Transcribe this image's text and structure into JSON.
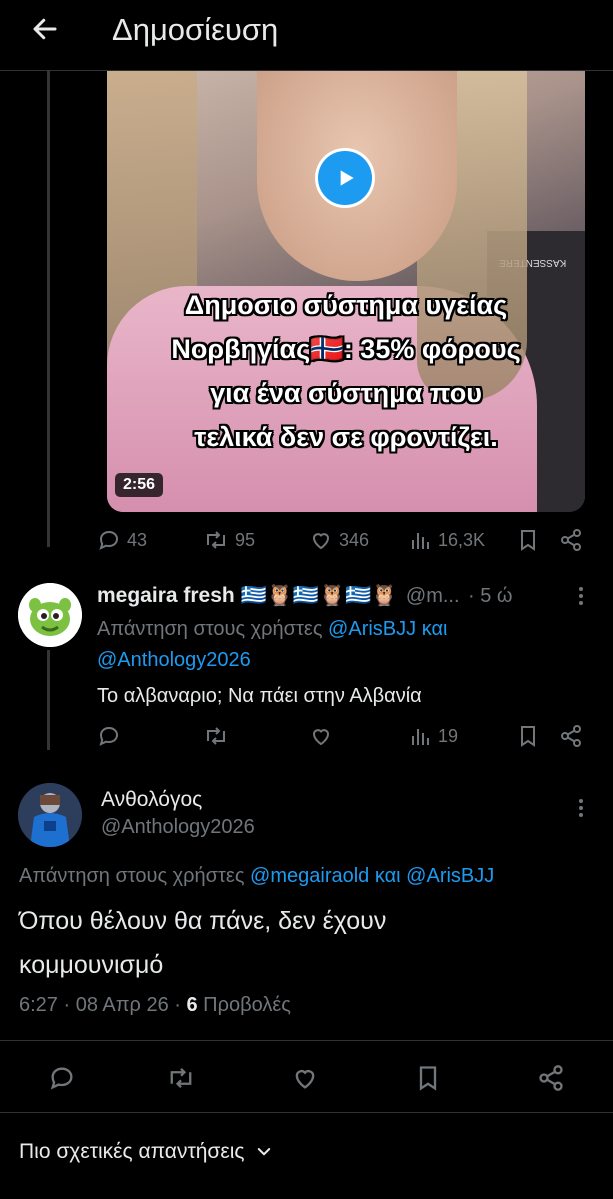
{
  "header": {
    "title": "Δημοσίευση"
  },
  "video": {
    "caption_lines": [
      "Δημοσιο σύστημα υγείας",
      "Νορβηγίας🇳🇴: 35% φόρους",
      "για ένα σύστημα που",
      "τελικά δεν σε φροντίζει."
    ],
    "duration": "2:56",
    "overlay_text": "KASSENTERE"
  },
  "post_stats": {
    "replies": "43",
    "reposts": "95",
    "likes": "346",
    "views": "16,3K"
  },
  "reply1": {
    "name": "megaira fresh 🇬🇷🦉🇬🇷🦉🇬🇷🦉",
    "handle": "@m...",
    "time": "· 5 ώ",
    "reply_prefix": "Απάντηση στους χρήστες ",
    "mention1": "@ArisBJJ",
    "and": " και",
    "mention2": "@Anthology2026",
    "text": "Το αλβαναριο; Να πάει στην Αλβανία",
    "views": "19"
  },
  "reply2": {
    "name": "Ανθολόγος",
    "handle": "@Anthology2026",
    "reply_prefix": "Απάντηση στους χρήστες ",
    "mention1": "@megairaold",
    "and": " και ",
    "mention2": "@ArisBJJ",
    "text_line1": "Όπου θέλουν θα πάνε, δεν έχουν",
    "text_line2": "κομμουνισμό",
    "timestamp": "6:27 · 08 Απρ 26 · ",
    "views_count": "6",
    "views_label": " Προβολές"
  },
  "footer": {
    "relevant_label": "Πιο σχετικές απαντήσεις"
  },
  "colors": {
    "accent": "#1d9bf0",
    "muted": "#71767b",
    "background": "#000000"
  }
}
